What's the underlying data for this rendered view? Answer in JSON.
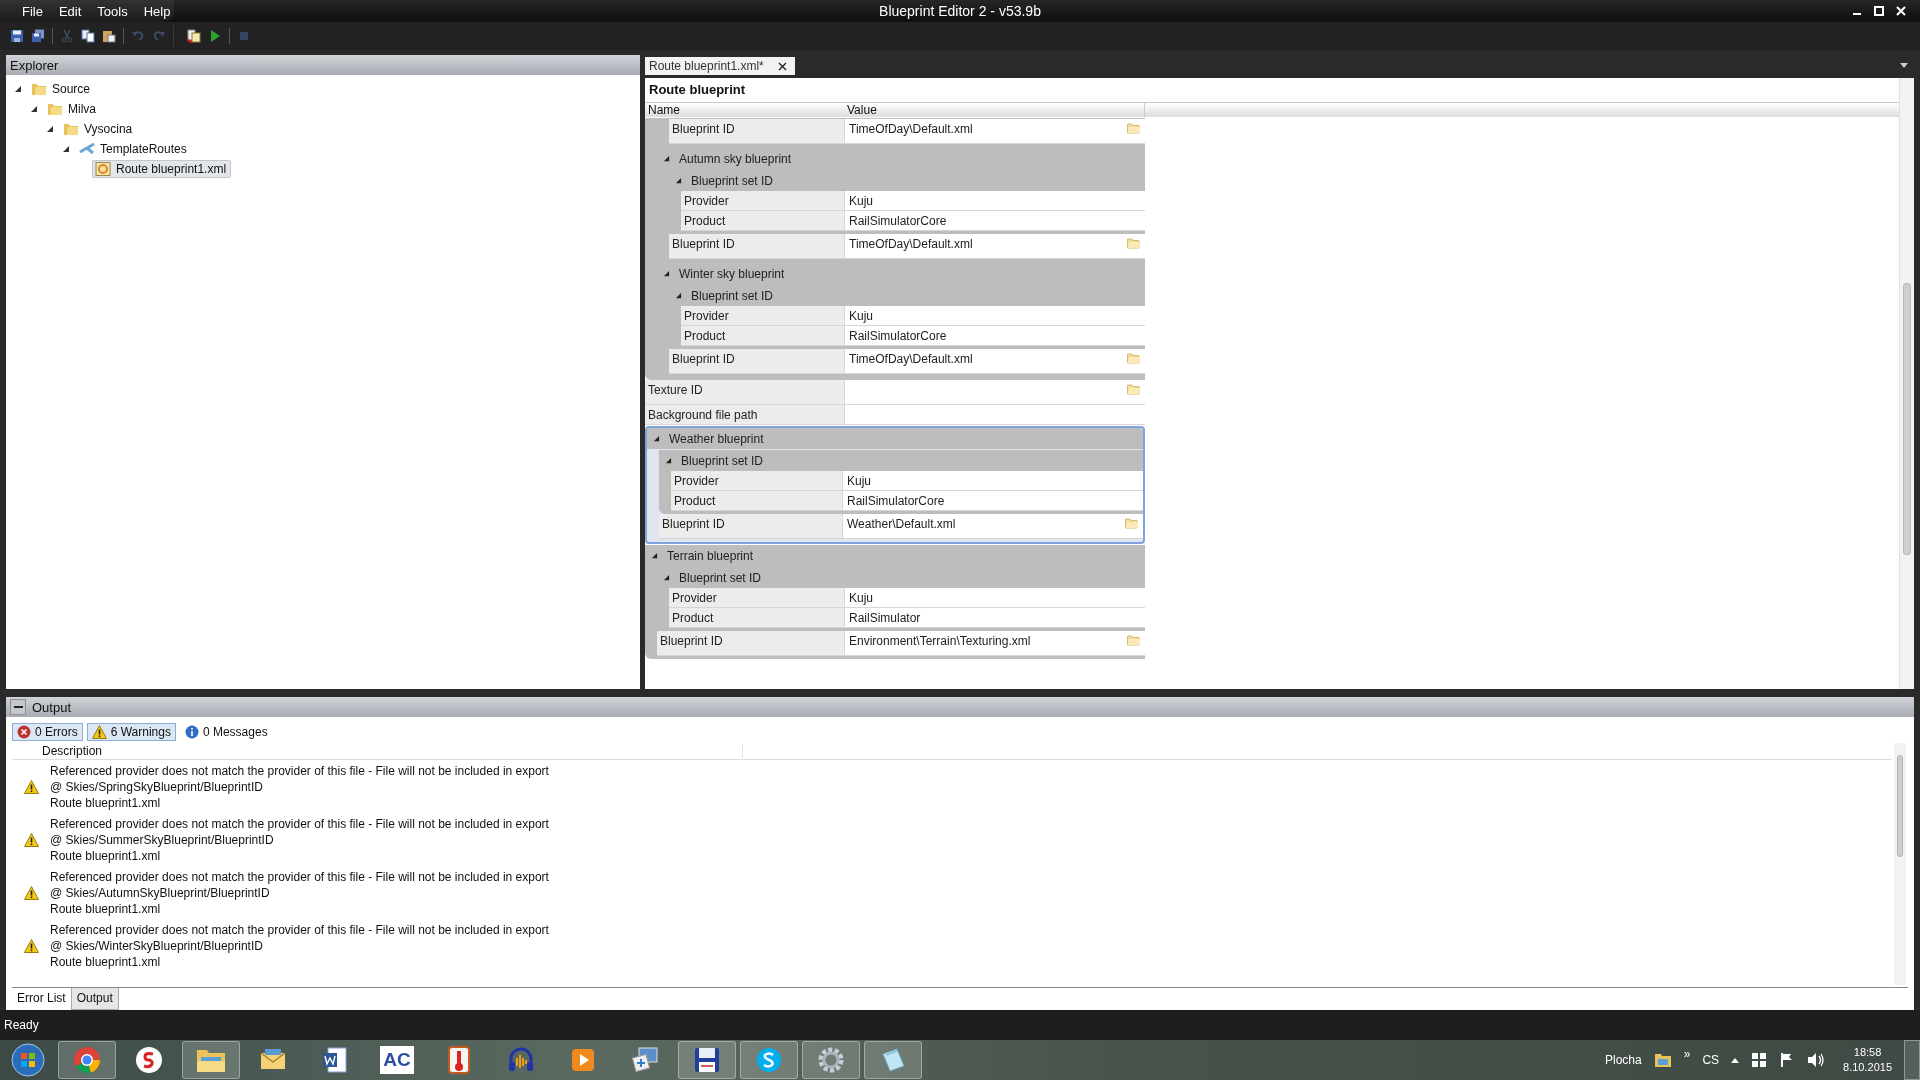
{
  "window": {
    "title": "Blueprint Editor 2 - v53.9b"
  },
  "menu": [
    "File",
    "Edit",
    "Tools",
    "Help"
  ],
  "toolbar": [
    {
      "kind": "save",
      "disabled": false
    },
    {
      "kind": "save-all",
      "disabled": false
    },
    {
      "kind": "separator"
    },
    {
      "kind": "cut",
      "disabled": true
    },
    {
      "kind": "copy",
      "disabled": false
    },
    {
      "kind": "paste",
      "disabled": false
    },
    {
      "kind": "separator"
    },
    {
      "kind": "undo",
      "disabled": true
    },
    {
      "kind": "redo",
      "disabled": true
    },
    {
      "kind": "gap"
    },
    {
      "kind": "export",
      "disabled": false
    },
    {
      "kind": "run",
      "disabled": false
    },
    {
      "kind": "separator"
    },
    {
      "kind": "stop",
      "disabled": true
    }
  ],
  "explorer": {
    "title": "Explorer",
    "items": [
      {
        "label": "Source",
        "kind": "folder",
        "expanded": true,
        "selected": false,
        "children": [
          {
            "label": "Milva",
            "kind": "folder",
            "expanded": true,
            "selected": false,
            "children": [
              {
                "label": "Vysocina",
                "kind": "folder",
                "expanded": true,
                "selected": false,
                "children": [
                  {
                    "label": "TemplateRoutes",
                    "kind": "routes",
                    "expanded": true,
                    "selected": false,
                    "children": [
                      {
                        "label": "Route blueprint1.xml",
                        "kind": "file",
                        "selected": true
                      }
                    ]
                  }
                ]
              }
            ]
          }
        ]
      }
    ]
  },
  "editor": {
    "tabs": [
      {
        "label": "Route blueprint1.xml*",
        "selected": true
      }
    ],
    "heading": "Route blueprint",
    "columns": [
      "Name",
      "Value"
    ],
    "items": [
      {
        "kind": "group",
        "children": [
          {
            "kind": "group",
            "children": [
              {
                "kind": "prop",
                "name": "Blueprint ID",
                "value": "TimeOfDay\\Default.xml",
                "browse": true
              }
            ]
          },
          {
            "kind": "group",
            "label": "Autumn sky blueprint",
            "expanded": true,
            "selected": false,
            "children": [
              {
                "kind": "group",
                "label": "Blueprint set ID",
                "expanded": true,
                "selected": false,
                "children": [
                  {
                    "kind": "prop",
                    "name": "Provider",
                    "value": "Kuju"
                  },
                  {
                    "kind": "prop",
                    "name": "Product",
                    "value": "RailSimulatorCore"
                  }
                ]
              },
              {
                "kind": "prop",
                "name": "Blueprint ID",
                "value": "TimeOfDay\\Default.xml",
                "browse": true
              }
            ]
          },
          {
            "kind": "group",
            "label": "Winter sky blueprint",
            "expanded": true,
            "selected": false,
            "children": [
              {
                "kind": "group",
                "label": "Blueprint set ID",
                "expanded": true,
                "selected": false,
                "children": [
                  {
                    "kind": "prop",
                    "name": "Provider",
                    "value": "Kuju"
                  },
                  {
                    "kind": "prop",
                    "name": "Product",
                    "value": "RailSimulatorCore"
                  }
                ]
              },
              {
                "kind": "prop",
                "name": "Blueprint ID",
                "value": "TimeOfDay\\Default.xml",
                "browse": true
              }
            ]
          }
        ]
      },
      {
        "kind": "prop",
        "name": "Texture ID",
        "browse": true
      },
      {
        "kind": "prop",
        "name": "Background file path"
      },
      {
        "kind": "group",
        "label": "Weather blueprint",
        "expanded": true,
        "selected": true,
        "children": [
          {
            "kind": "group",
            "label": "Blueprint set ID",
            "expanded": true,
            "selected": false,
            "children": [
              {
                "kind": "prop",
                "name": "Provider",
                "value": "Kuju"
              },
              {
                "kind": "prop",
                "name": "Product",
                "value": "RailSimulatorCore"
              }
            ]
          },
          {
            "kind": "prop",
            "name": "Blueprint ID",
            "value": "Weather\\Default.xml",
            "browse": true
          }
        ]
      },
      {
        "kind": "group",
        "label": "Terrain blueprint",
        "expanded": true,
        "selected": false,
        "children": [
          {
            "kind": "group",
            "label": "Blueprint set ID",
            "expanded": true,
            "selected": false,
            "children": [
              {
                "kind": "prop",
                "name": "Provider",
                "value": "Kuju"
              },
              {
                "kind": "prop",
                "name": "Product",
                "value": "RailSimulator"
              }
            ]
          },
          {
            "kind": "prop",
            "name": "Blueprint ID",
            "value": "Environment\\Terrain\\Texturing.xml",
            "browse": true
          }
        ]
      }
    ]
  },
  "output": {
    "title": "Output",
    "filters": [
      {
        "kind": "error",
        "label": "0 Errors",
        "selected": true
      },
      {
        "kind": "warning",
        "label": "6 Warnings",
        "selected": true
      },
      {
        "kind": "info",
        "label": "0 Messages",
        "selected": false
      }
    ],
    "column": "Description",
    "messages": [
      {
        "kind": "warning",
        "text": "Referenced provider does not match the provider of this file - File will not be included in export",
        "location": "@ Skies/SpringSkyBlueprint/BlueprintID",
        "file": "Route blueprint1.xml"
      },
      {
        "kind": "warning",
        "text": "Referenced provider does not match the provider of this file - File will not be included in export",
        "location": "@ Skies/SummerSkyBlueprint/BlueprintID",
        "file": "Route blueprint1.xml"
      },
      {
        "kind": "warning",
        "text": "Referenced provider does not match the provider of this file - File will not be included in export",
        "location": "@ Skies/AutumnSkyBlueprint/BlueprintID",
        "file": "Route blueprint1.xml"
      },
      {
        "kind": "warning",
        "text": "Referenced provider does not match the provider of this file - File will not be included in export",
        "location": "@ Skies/WinterSkyBlueprint/BlueprintID",
        "file": "Route blueprint1.xml"
      }
    ],
    "tabs": [
      {
        "label": "Error List",
        "selected": true
      },
      {
        "label": "Output",
        "selected": false
      }
    ]
  },
  "status_bar": "Ready",
  "taskbar": {
    "apps": [
      {
        "kind": "chrome",
        "open": true
      },
      {
        "kind": "s-app",
        "open": false
      },
      {
        "kind": "explorer",
        "open": true
      },
      {
        "kind": "mail",
        "open": false
      },
      {
        "kind": "word",
        "open": false
      },
      {
        "kind": "ac",
        "label": "AC",
        "open": false
      },
      {
        "kind": "thermometer",
        "open": false
      },
      {
        "kind": "headphones",
        "open": false
      },
      {
        "kind": "media",
        "open": false
      },
      {
        "kind": "remote",
        "open": false
      },
      {
        "kind": "floppy",
        "open": true
      },
      {
        "kind": "skype",
        "open": true
      },
      {
        "kind": "gear",
        "open": true
      },
      {
        "kind": "notepad",
        "open": true
      }
    ],
    "desktop": "Plocha",
    "chevron": "»",
    "language": "CS",
    "time": "18:58",
    "date": "8.10.2015"
  }
}
